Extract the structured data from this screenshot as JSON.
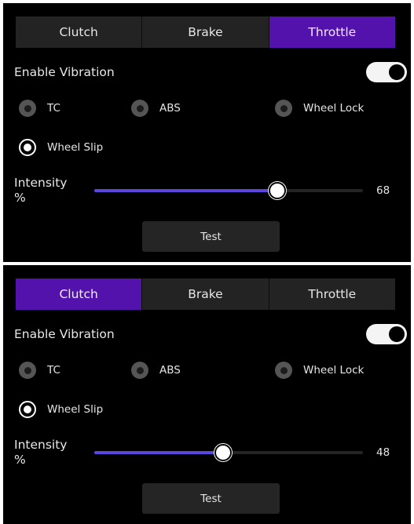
{
  "panels": [
    {
      "tabs": [
        {
          "label": "Clutch",
          "active": false
        },
        {
          "label": "Brake",
          "active": false
        },
        {
          "label": "Throttle",
          "active": true
        }
      ],
      "enable_vibration": {
        "label": "Enable Vibration",
        "enabled": true
      },
      "effects": [
        {
          "label": "TC",
          "selected": false
        },
        {
          "label": "ABS",
          "selected": false
        },
        {
          "label": "Wheel Lock",
          "selected": false
        },
        {
          "label": "Wheel Slip",
          "selected": true
        }
      ],
      "intensity": {
        "label_line1": "Intensity",
        "label_line2": "%",
        "value": "68"
      },
      "test_label": "Test"
    },
    {
      "tabs": [
        {
          "label": "Clutch",
          "active": true
        },
        {
          "label": "Brake",
          "active": false
        },
        {
          "label": "Throttle",
          "active": false
        }
      ],
      "enable_vibration": {
        "label": "Enable Vibration",
        "enabled": true
      },
      "effects": [
        {
          "label": "TC",
          "selected": false
        },
        {
          "label": "ABS",
          "selected": false
        },
        {
          "label": "Wheel Lock",
          "selected": false
        },
        {
          "label": "Wheel Slip",
          "selected": true
        }
      ],
      "intensity": {
        "label_line1": "Intensity",
        "label_line2": "%",
        "value": "48"
      },
      "test_label": "Test"
    }
  ],
  "colors": {
    "accent_tab": "#5412ad",
    "slider_fill": "#5b47e0",
    "background": "#000000",
    "tab_inactive": "#232323"
  }
}
